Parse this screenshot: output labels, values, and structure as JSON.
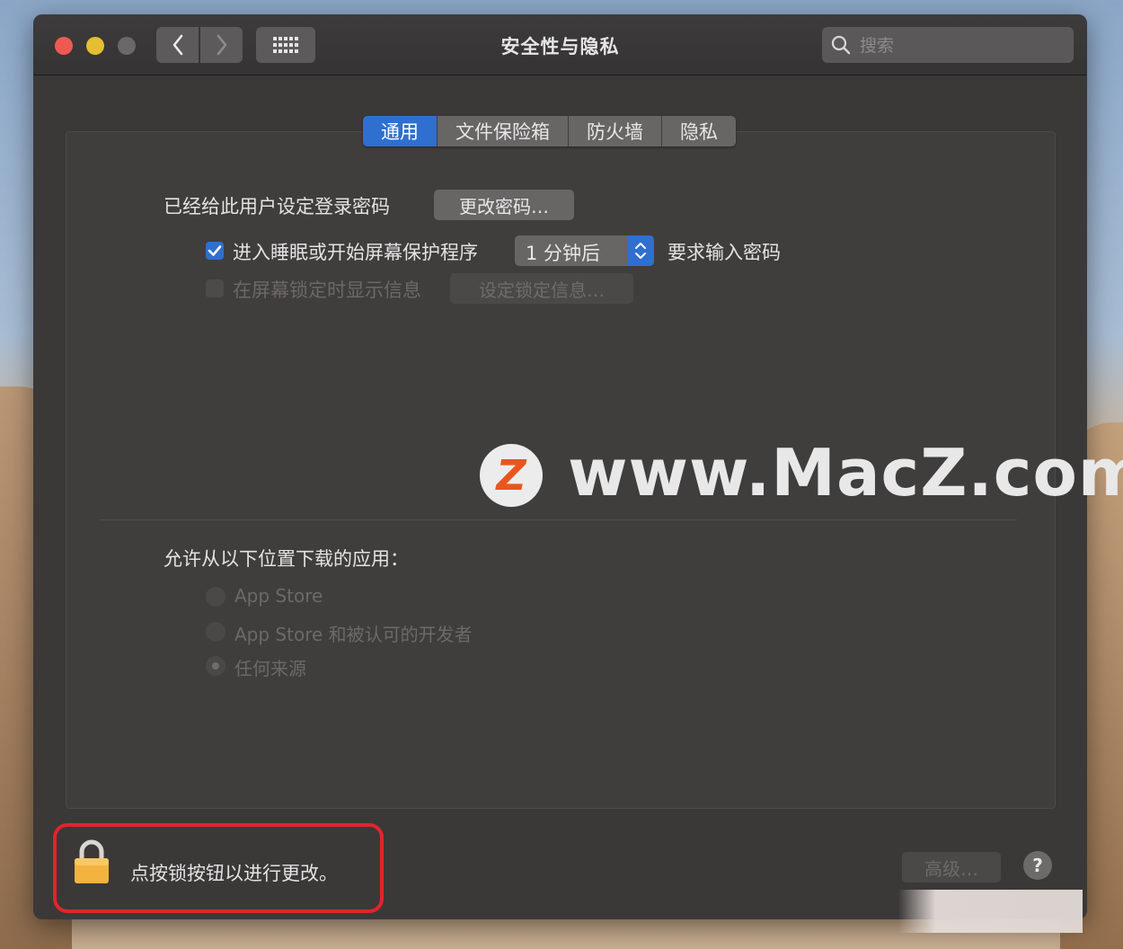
{
  "window": {
    "title": "安全性与隐私"
  },
  "toolbar": {
    "back_icon": "chevron-left-icon",
    "forward_icon": "chevron-right-icon",
    "grid_icon": "grid-icon"
  },
  "search": {
    "placeholder": "搜索"
  },
  "tabs": [
    {
      "label": "通用",
      "active": true
    },
    {
      "label": "文件保险箱",
      "active": false
    },
    {
      "label": "防火墙",
      "active": false
    },
    {
      "label": "隐私",
      "active": false
    }
  ],
  "general": {
    "password_label": "已经给此用户设定登录密码",
    "change_password_button": "更改密码…",
    "sleep_checkbox_label": "进入睡眠或开始屏幕保护程序",
    "sleep_checkbox_checked": true,
    "delay_select_value": "1 分钟后",
    "require_password_label": "要求输入密码",
    "lock_message_checkbox_label": "在屏幕锁定时显示信息",
    "lock_message_checkbox_checked": false,
    "set_lock_message_button": "设定锁定信息…"
  },
  "downloads": {
    "heading": "允许从以下位置下载的应用：",
    "options": [
      {
        "label": "App Store",
        "selected": false
      },
      {
        "label": "App Store 和被认可的开发者",
        "selected": false
      },
      {
        "label": "任何来源",
        "selected": true
      }
    ]
  },
  "footer": {
    "lock_text": "点按锁按钮以进行更改。",
    "advanced_button": "高级…",
    "help_button": "?"
  },
  "watermark": {
    "logo_letter": "Z",
    "text": "www.MacZ.com"
  },
  "colors": {
    "accent": "#2f6fd0",
    "highlight_box": "#e0252b",
    "traffic_red": "#ed5a53",
    "traffic_yellow": "#e6be32"
  }
}
